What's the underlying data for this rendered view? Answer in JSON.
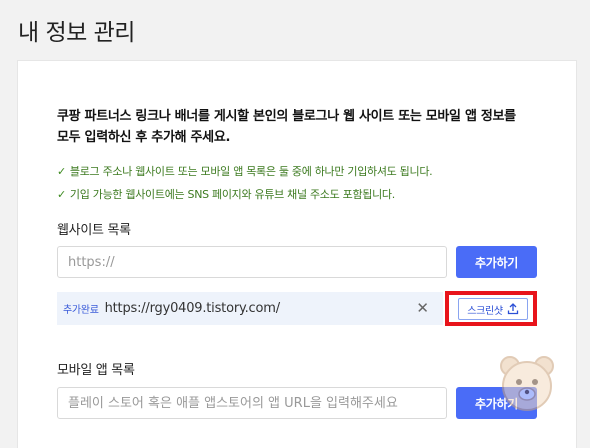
{
  "page": {
    "title": "내 정보 관리"
  },
  "intro": {
    "line1": "쿠팡 파트너스 링크나 배너를 게시할 본인의 블로그나 웹 사이트 또는 모바일 앱 정보를",
    "line2": "모두 입력하신 후 추가해 주세요."
  },
  "notices": [
    "블로그 주소나 웹사이트 또는 모바일 앱 목록은 둘 중에 하나만 기입하셔도 됩니다.",
    "기입 가능한 웹사이트에는 SNS 페이지와 유튜브 채널 주소도 포함됩니다."
  ],
  "website": {
    "label": "웹사이트 목록",
    "placeholder": "https://",
    "add_label": "추가하기",
    "entries": [
      {
        "badge": "추가완료",
        "url": "https://rgy0409.tistory.com/",
        "screenshot_label": "스크린샷"
      }
    ]
  },
  "mobile_app": {
    "label": "모바일 앱 목록",
    "placeholder": "플레이 스토어 혹은 애플 앱스토어의 앱 URL을 입력해주세요",
    "add_label": "추가하기"
  },
  "icons": {
    "check": "check-icon",
    "close": "close-icon",
    "upload": "upload-icon"
  },
  "colors": {
    "accent": "#4a6cf7",
    "success": "#3c7a1f",
    "highlight": "#e8141b"
  }
}
